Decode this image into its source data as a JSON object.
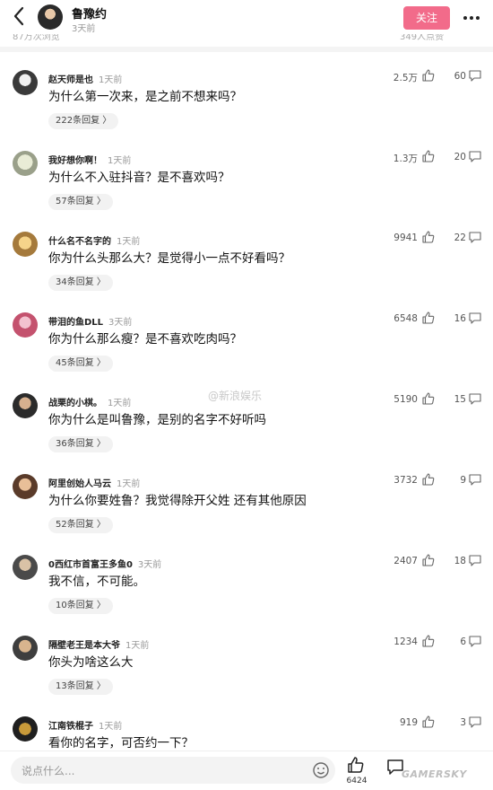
{
  "header": {
    "author_name": "鲁豫约",
    "author_time": "3天前",
    "follow_label": "关注",
    "views_partial": "87万次浏览",
    "likes_partial": "349人点赞"
  },
  "watermark": "@新浪娱乐",
  "comments": [
    {
      "user": "赵天师是也",
      "time": "1天前",
      "text": "为什么第一次来，是之前不想来吗？",
      "replies": "222条回复 〉",
      "likes": "2.5万",
      "comment_count": "60"
    },
    {
      "user": "我好想你啊！",
      "time": "1天前",
      "text": "为什么不入驻抖音？是不喜欢吗？",
      "replies": "57条回复 〉",
      "likes": "1.3万",
      "comment_count": "20"
    },
    {
      "user": "什么名不名字的",
      "time": "1天前",
      "text": "你为什么头那么大？是觉得小一点不好看吗？",
      "replies": "34条回复 〉",
      "likes": "9941",
      "comment_count": "22"
    },
    {
      "user": "带泪的鱼DLL",
      "time": "3天前",
      "text": "你为什么那么瘦？是不喜欢吃肉吗？",
      "replies": "45条回复 〉",
      "likes": "6548",
      "comment_count": "16"
    },
    {
      "user": "战栗的小棋。",
      "time": "1天前",
      "text": "你为什么是叫鲁豫，是别的名字不好听吗",
      "replies": "36条回复 〉",
      "likes": "5190",
      "comment_count": "15"
    },
    {
      "user": "阿里创始人马云",
      "time": "1天前",
      "text": "为什么你要姓鲁？我觉得除开父姓 还有其他原因",
      "replies": "52条回复 〉",
      "likes": "3732",
      "comment_count": "9"
    },
    {
      "user": "0西红市首富王多鱼0",
      "time": "3天前",
      "text": "我不信，不可能。",
      "replies": "10条回复 〉",
      "likes": "2407",
      "comment_count": "18"
    },
    {
      "user": "隔壁老王是本大爷",
      "time": "1天前",
      "text": "你头为啥这么大",
      "replies": "13条回复 〉",
      "likes": "1234",
      "comment_count": "6"
    },
    {
      "user": "江南铁棍子",
      "time": "1天前",
      "text": "看你的名字，可否约一下？",
      "replies": "",
      "likes": "919",
      "comment_count": "3"
    }
  ],
  "bottom": {
    "input_placeholder": "说点什么...",
    "like_count": "6424",
    "brand": "GAMERSKY"
  },
  "colors": {
    "follow": "#f26b8a",
    "reply_pill": "#f2f2f2"
  }
}
